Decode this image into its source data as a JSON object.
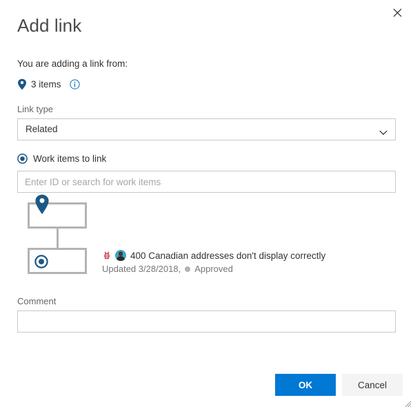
{
  "dialog": {
    "title": "Add link",
    "close_label": "Close",
    "close_icon": "close-icon"
  },
  "intro": {
    "text": "You are adding a link from:",
    "pin_icon": "location-pin-icon",
    "items_count": "3 items",
    "info_icon": "info-circle-icon"
  },
  "link_type": {
    "label": "Link type",
    "value": "Related",
    "chevron_icon": "chevron-down-icon",
    "options": [
      "Related"
    ]
  },
  "work_items": {
    "radio_label": "Work items to link",
    "radio_icon": "radio-selected-icon",
    "search_value": "",
    "search_placeholder": "Enter ID or search for work items"
  },
  "tree": {
    "parent_icon": "location-pin-icon",
    "child_icon": "target-circle-icon",
    "item": {
      "type_icon": "bug-icon",
      "avatar_icon": "user-avatar-icon",
      "title": "400 Canadian addresses don't display correctly",
      "updated": "Updated 3/28/2018,",
      "state": "Approved",
      "state_dot_color": "#b2b2b2"
    }
  },
  "comment": {
    "label": "Comment",
    "value": "",
    "placeholder": ""
  },
  "footer": {
    "ok_label": "OK",
    "cancel_label": "Cancel",
    "resize_grip_icon": "resize-grip-icon"
  },
  "colors": {
    "accent": "#0078d4",
    "icon_blue": "#1c5886",
    "border": "#c8c8c8",
    "tree_border": "#b3b3b3"
  }
}
